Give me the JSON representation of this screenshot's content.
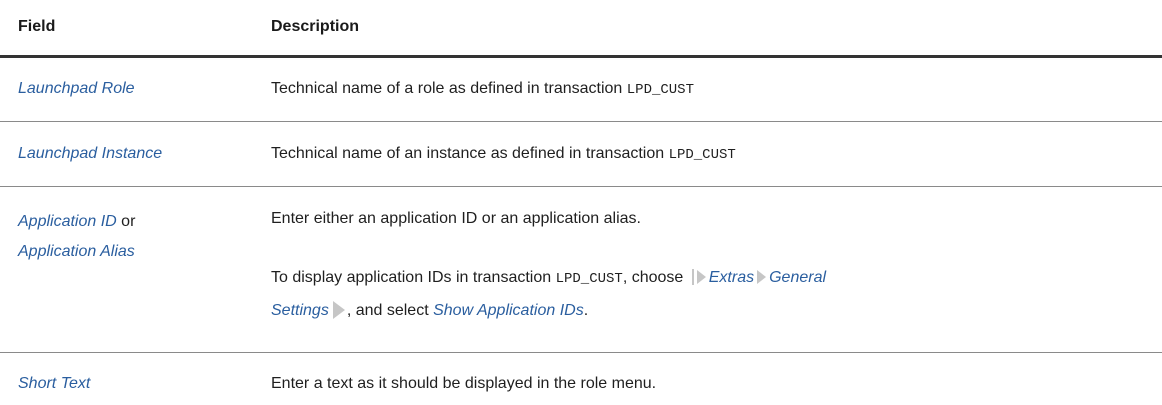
{
  "table": {
    "headers": {
      "field": "Field",
      "description": "Description"
    },
    "rows": [
      {
        "field": "Launchpad Role",
        "description": "Technical name of a role as defined in transaction ",
        "code": "LPD_CUST"
      },
      {
        "field": "Launchpad Instance",
        "description": "Technical name of an instance as defined in transaction ",
        "code": "LPD_CUST"
      },
      {
        "field_part1": "Application ID",
        "field_connector": " or",
        "field_part2": "Application Alias",
        "description_1": "Enter either an application ID or an application alias.",
        "description_2_pre": "To display application IDs in transaction ",
        "code": "LPD_CUST",
        "description_2_mid": ", choose ",
        "menu_1": "Extras",
        "menu_2": "General",
        "menu_2b": "Settings",
        "description_2_post": ", and select ",
        "option": "Show Application IDs",
        "period": "."
      },
      {
        "field": "Short Text",
        "description": "Enter a text as it should be displayed in the role menu."
      }
    ]
  },
  "colors": {
    "link_blue": "#2a5e9f",
    "text": "#1f1f1f",
    "rule": "#8a8a8a",
    "header_rule": "#333333",
    "menu_arrow": "#c6c6c6"
  },
  "icons": [
    "menu-path-start-icon",
    "menu-path-arrow-icon",
    "menu-path-end-icon"
  ]
}
